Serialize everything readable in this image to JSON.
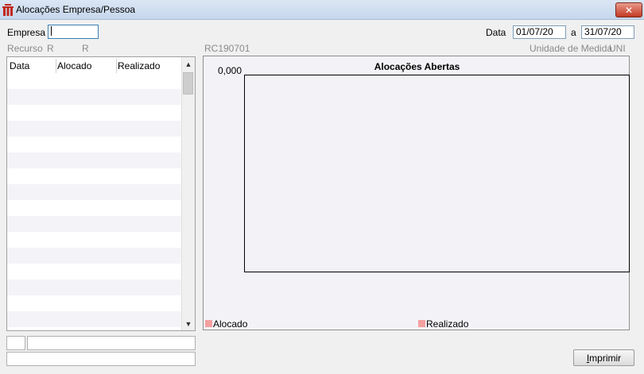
{
  "window": {
    "title": "Alocações Empresa/Pessoa",
    "close_glyph": "✕"
  },
  "filters": {
    "empresa_label": "Empresa",
    "empresa_value": "",
    "data_label": "Data",
    "date_from": "01/07/20",
    "date_sep": "a",
    "date_to": "31/07/20"
  },
  "info": {
    "recurso_label": "Recurso",
    "recurso_value1": "R",
    "recurso_value2": "R",
    "code": "RC190701",
    "unidade_label": "Unidade de Medida",
    "unidade_value": "UNI"
  },
  "grid": {
    "columns": [
      "Data",
      "Alocado",
      "Realizado"
    ],
    "row_count": 16,
    "scroll_up": "▲",
    "scroll_down": "▼"
  },
  "chart_data": {
    "type": "bar",
    "title": "Alocações Abertas",
    "y_ticks": [
      "0,000"
    ],
    "categories": [],
    "series": [
      {
        "name": "Alocado",
        "values": [],
        "color": "#f4a0a0"
      },
      {
        "name": "Realizado",
        "values": [],
        "color": "#f4a0a0"
      }
    ],
    "legend_position": "bottom"
  },
  "buttons": {
    "print_label": "Imprimir"
  }
}
